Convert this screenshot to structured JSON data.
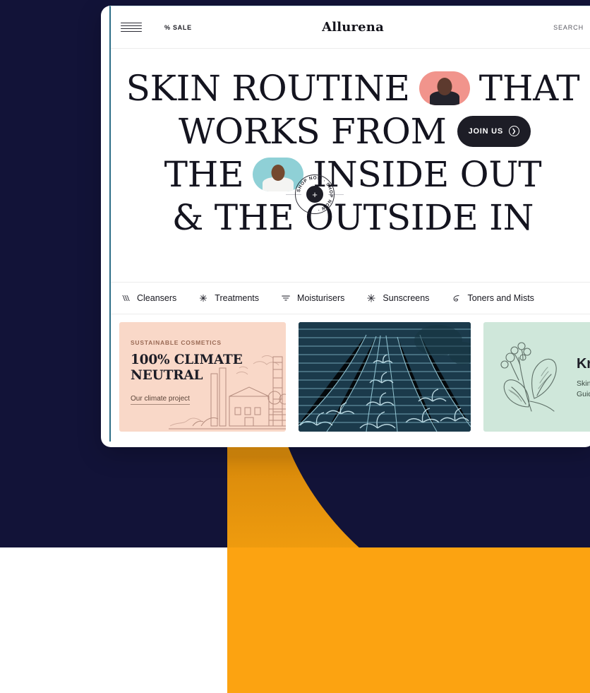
{
  "page": {
    "background_navy": "#121338",
    "background_white": "#ffffff",
    "ribbon_color": "#FCA311",
    "ribbon_shadow_color": "#D98A0B"
  },
  "browser": {
    "frame_color": "#ffffff",
    "viewport_border_color": "#2d6e86"
  },
  "header": {
    "menu_icon": "hamburger-icon",
    "sale_label": "% SALE",
    "brand": "Allurena",
    "search_label": "SEARCH"
  },
  "hero": {
    "line1_a": "SKIN ROUTINE",
    "line1_b": "THAT",
    "line2_a": "WORKS FROM",
    "line3_a": "THE",
    "line3_b": "INSIDE OUT",
    "line4_a": "& THE OUTSIDE IN",
    "shop_badge": "SHOP NOW · SHOP NOW ·",
    "shop_badge_icon": "plus-icon",
    "join_label": "JOIN US",
    "join_arrow_icon": "chevron-right-icon",
    "pill_one_image": "portrait-pink-pill",
    "pill_two_image": "portrait-teal-pill",
    "pill_one_color": "#f1948c",
    "pill_two_color": "#8fd0d6"
  },
  "categories": [
    {
      "label": "Cleansers",
      "icon": "waves-icon"
    },
    {
      "label": "Treatments",
      "icon": "sparkle-icon"
    },
    {
      "label": "Moisturisers",
      "icon": "filter-lines-icon"
    },
    {
      "label": "Sunscreens",
      "icon": "sun-rays-icon"
    },
    {
      "label": "Toners and Mists",
      "icon": "leaf-swirl-icon"
    }
  ],
  "cards": [
    {
      "kicker": "SUSTAINABLE COSMETICS",
      "title_line1": "100% CLIMATE",
      "title_line2": "NEUTRAL",
      "link": "Our climate project",
      "background": "#f9d8c8",
      "art": "factory-engraving"
    },
    {
      "background": "#123040",
      "art": "crop-rows-engraving"
    },
    {
      "title": "Know",
      "subtitle_line1": "Skin-Care",
      "subtitle_line2": "Guide",
      "background": "#cfe7da",
      "art": "botanical-leaf-engraving"
    }
  ]
}
